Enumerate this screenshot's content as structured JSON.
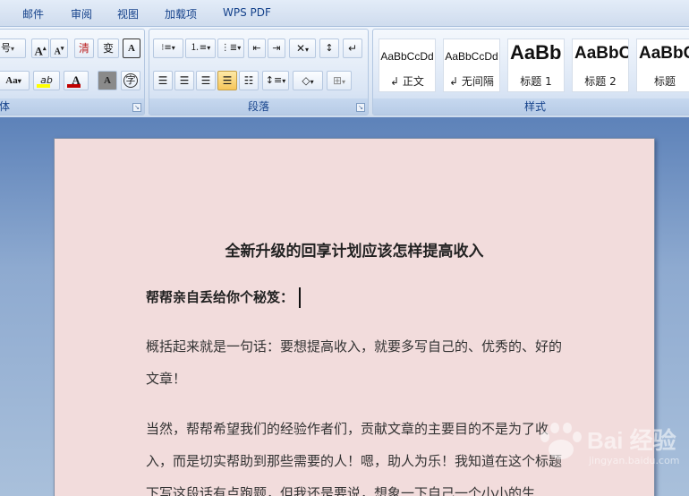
{
  "menu": {
    "tabs": [
      "邮件",
      "审阅",
      "视图",
      "加载项",
      "WPS PDF"
    ]
  },
  "ribbon": {
    "font_group": {
      "label": "体",
      "size_fragment": "号",
      "grow_label": "A",
      "shrink_label": "A",
      "clear_label": "清",
      "phonetic_label": "变",
      "border_char_label": "A",
      "case_label": "Aa",
      "highlight_label": "ab",
      "color_label": "A",
      "shade_label": "A",
      "enclose_label": "字"
    },
    "paragraph_group": {
      "label": "段落"
    },
    "styles_group": {
      "label": "样式",
      "styles": [
        {
          "sample": "AaBbCcDd",
          "name": "正文"
        },
        {
          "sample": "AaBbCcDd",
          "name": "无间隔"
        },
        {
          "sample": "AaBb",
          "name": "标题 1"
        },
        {
          "sample": "AaBbC",
          "name": "标题 2"
        },
        {
          "sample": "AaBbC",
          "name": "标题"
        }
      ]
    }
  },
  "document": {
    "title": "全新升级的回享计划应该怎样提高收入",
    "subtitle": "帮帮亲自丢给你个秘笈：",
    "paragraphs": [
      "概括起来就是一句话：要想提高收入，就要多写自己的、优秀的、好的文章！",
      "当然，帮帮希望我们的经验作者们，贡献文章的主要目的不是为了收入，而是切实帮助到那些需要的人！嗯，助人为乐！我知道在这个标题下写这段话有点跑题，但我还是要说，想象一下自己一个小小的生"
    ]
  },
  "watermark": {
    "text": "Bai 经验",
    "url": "jingyan.baidu.com"
  },
  "colors": {
    "ribbon_text": "#15428b",
    "page_bg": "#f2dcdc",
    "highlight_yellow": "#ffff00",
    "font_red": "#c00000"
  }
}
